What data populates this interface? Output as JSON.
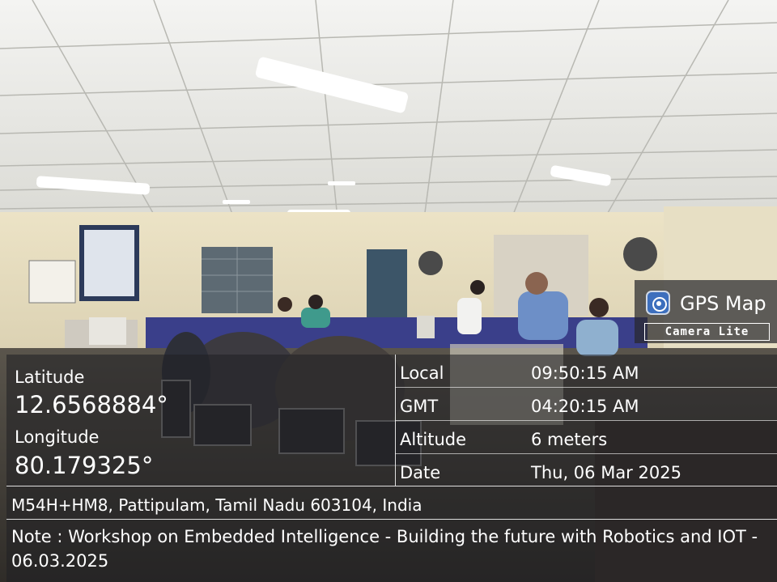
{
  "badge": {
    "app_name": "GPS Map",
    "edition": "Camera Lite",
    "icon": "camera-lens-icon"
  },
  "coords": {
    "latitude_label": "Latitude",
    "latitude_value": "12.6568884°",
    "longitude_label": "Longitude",
    "longitude_value": "80.179325°"
  },
  "info": {
    "local_label": "Local",
    "local_value": "09:50:15 AM",
    "gmt_label": "GMT",
    "gmt_value": "04:20:15 AM",
    "altitude_label": "Altitude",
    "altitude_value": "6 meters",
    "date_label": "Date",
    "date_value": "Thu, 06 Mar 2025"
  },
  "address": "M54H+HM8, Pattipulam, Tamil Nadu 603104, India",
  "note": "Note : Workshop on Embedded Intelligence - Building the future with Robotics and IOT - 06.03.2025"
}
